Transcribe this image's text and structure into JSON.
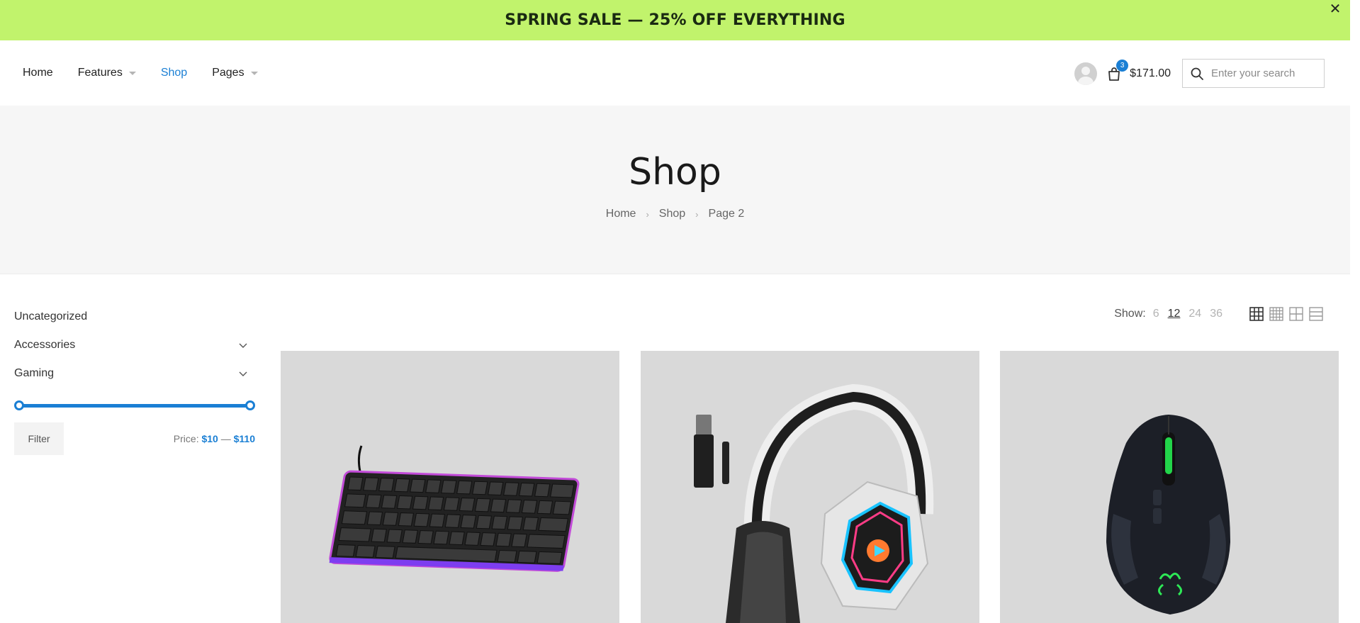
{
  "banner": {
    "text": "SPRING SALE — 25% OFF EVERYTHING",
    "close": "✕",
    "color": "#c1f36c"
  },
  "nav": {
    "items": [
      {
        "label": "Home"
      },
      {
        "label": "Features"
      },
      {
        "label": "Shop"
      },
      {
        "label": "Pages"
      }
    ],
    "accent": "#1a7fd4"
  },
  "header": {
    "cart_count": "3",
    "cart_total": "$171.00",
    "search_placeholder": "Enter your search"
  },
  "hero": {
    "title": "Shop",
    "breadcrumb": [
      "Home",
      "Shop",
      "Page 2"
    ]
  },
  "sidebar": {
    "categories": [
      {
        "label": "Uncategorized"
      },
      {
        "label": "Accessories"
      },
      {
        "label": "Gaming"
      }
    ],
    "filter_label": "Filter",
    "price_label": "Price:",
    "price_min": "$10",
    "price_sep": "—",
    "price_max": "$110",
    "price_range_fraction": [
      0,
      1
    ]
  },
  "toolbar": {
    "show_label": "Show:",
    "show_options": [
      "6",
      "12",
      "24",
      "36"
    ],
    "selected": "12",
    "view_icons": [
      "grid-3-icon",
      "grid-4-icon",
      "grid-2-icon",
      "list-icon"
    ]
  },
  "products": [
    {
      "image": "keyboard-image"
    },
    {
      "image": "headset-image"
    },
    {
      "image": "mouse-image"
    }
  ]
}
